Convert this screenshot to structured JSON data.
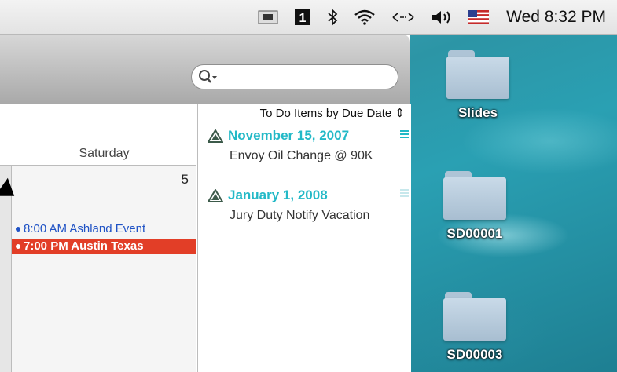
{
  "menubar": {
    "clock": "Wed 8:32 PM",
    "icons": [
      "drive-icon",
      "spaces-icon",
      "bluetooth-icon",
      "wifi-icon",
      "sync-icon",
      "volume-icon",
      "us-flag-icon"
    ]
  },
  "toolbar": {
    "search_placeholder": ""
  },
  "calendar": {
    "day_name": "Saturday",
    "day_number": "5",
    "events": [
      {
        "label": "8:00 AM Ashland Event",
        "color": "#1f52c5"
      },
      {
        "label": "7:00 PM Austin Texas",
        "color": "#e23e27"
      }
    ]
  },
  "todo": {
    "header": "To Do Items by Due Date",
    "items": [
      {
        "date": "November 15, 2007",
        "text": "Envoy Oil Change @ 90K"
      },
      {
        "date": "January 1, 2008",
        "text": "Jury Duty Notify Vacation"
      }
    ],
    "accent_color": "#23b9c7"
  },
  "desktop": {
    "folders": [
      "Slides",
      "SD00001",
      "SD00003"
    ]
  }
}
